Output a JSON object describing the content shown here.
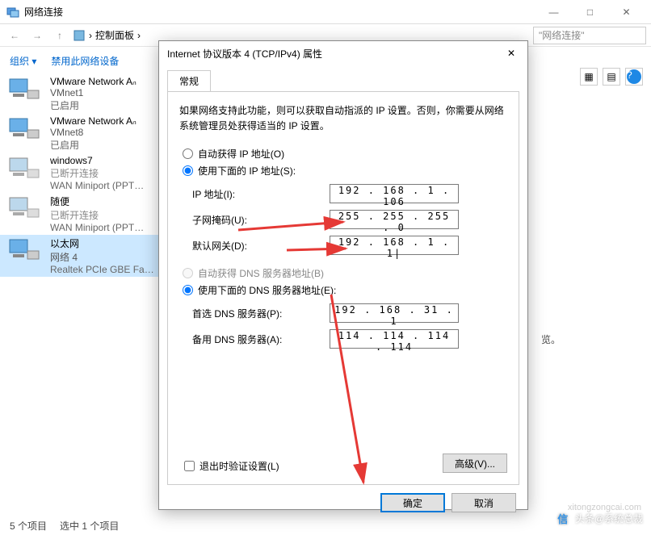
{
  "window": {
    "title": "网络连接",
    "minimize": "—",
    "maximize": "□",
    "close": "✕"
  },
  "nav": {
    "back": "←",
    "forward": "→",
    "up": "↑",
    "path_root": "控制面板",
    "chevron": "›",
    "search_placeholder": "\"网络连接\""
  },
  "toolbar": {
    "organize": "组织 ▾",
    "disable": "禁用此网络设备",
    "overview_tail": "览。"
  },
  "nics": [
    {
      "name": "VMware Network Aₙ",
      "status": "VMnet1",
      "status2": "已启用"
    },
    {
      "name": "VMware Network Aₙ",
      "status": "VMnet8",
      "status2": "已启用"
    },
    {
      "name": "windows7",
      "status": "已断开连接",
      "device": "WAN Miniport (PPT…"
    },
    {
      "name": "随便",
      "status": "已断开连接",
      "device": "WAN Miniport (PPT…"
    },
    {
      "name": "以太网",
      "status": "网络 4",
      "device": "Realtek PCIe GBE Fa…"
    }
  ],
  "statusbar": {
    "count": "5 个项目",
    "selected": "选中 1 个项目"
  },
  "dialog": {
    "title": "Internet 协议版本 4 (TCP/IPv4) 属性",
    "tab": "常规",
    "desc": "如果网络支持此功能，则可以获取自动指派的 IP 设置。否则，你需要从网络系统管理员处获得适当的 IP 设置。",
    "auto_ip": "自动获得 IP 地址(O)",
    "manual_ip": "使用下面的 IP 地址(S):",
    "ip_label": "IP 地址(I):",
    "ip_value": "192 . 168 .  1  . 106",
    "mask_label": "子网掩码(U):",
    "mask_value": "255 . 255 . 255 .  0",
    "gw_label": "默认网关(D):",
    "gw_value": "192 . 168 .  1  .  1|",
    "auto_dns": "自动获得 DNS 服务器地址(B)",
    "manual_dns": "使用下面的 DNS 服务器地址(E):",
    "dns1_label": "首选 DNS 服务器(P):",
    "dns1_value": "192 . 168 . 31 .  1",
    "dns2_label": "备用 DNS 服务器(A):",
    "dns2_value": "114 . 114 . 114 . 114",
    "validate": "退出时验证设置(L)",
    "advanced": "高级(V)...",
    "ok": "确定",
    "cancel": "取消"
  },
  "watermark": {
    "site": "xitongzongcai.com",
    "name": "头条@系统总裁"
  }
}
